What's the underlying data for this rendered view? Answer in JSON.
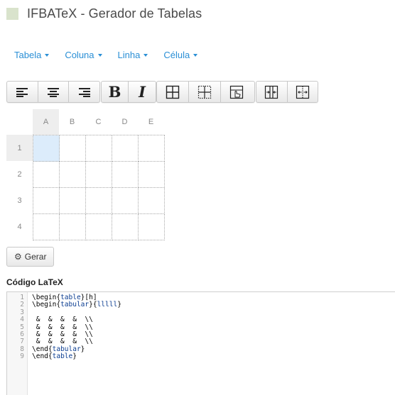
{
  "app": {
    "title": "IFBATeX - Gerador de Tabelas"
  },
  "menu": [
    {
      "label": "Tabela"
    },
    {
      "label": "Coluna"
    },
    {
      "label": "Linha"
    },
    {
      "label": "Célula"
    }
  ],
  "toolbar": {
    "groups": [
      [
        "align-left-icon",
        "align-center-icon",
        "align-right-icon"
      ],
      [
        "bold-icon",
        "italic-icon"
      ],
      [
        "all-borders-icon",
        "inner-borders-icon",
        "select-cells-icon"
      ],
      [
        "merge-cells-icon",
        "split-cells-icon"
      ]
    ],
    "bold_glyph": "B",
    "italic_glyph": "I"
  },
  "grid": {
    "columns": [
      "A",
      "B",
      "C",
      "D",
      "E"
    ],
    "rows": [
      "1",
      "2",
      "3",
      "4"
    ],
    "selected": {
      "row": "1",
      "column": "A"
    }
  },
  "gerar_button": {
    "label": "Gerar",
    "icon": "gears-icon"
  },
  "code_section": {
    "label": "Código LaTeX",
    "lines": [
      "\\begin{table}[h]",
      "\\begin{tabular}{lllll}",
      "",
      " &  &  &  &  \\\\",
      " &  &  &  &  \\\\",
      " &  &  &  &  \\\\",
      " &  &  &  &  \\\\",
      "\\end{tabular}",
      "\\end{table}"
    ]
  },
  "colors": {
    "accent": "#2a8fd6",
    "logo": "#d9e3cc",
    "selected_cell": "#dcecfb"
  }
}
